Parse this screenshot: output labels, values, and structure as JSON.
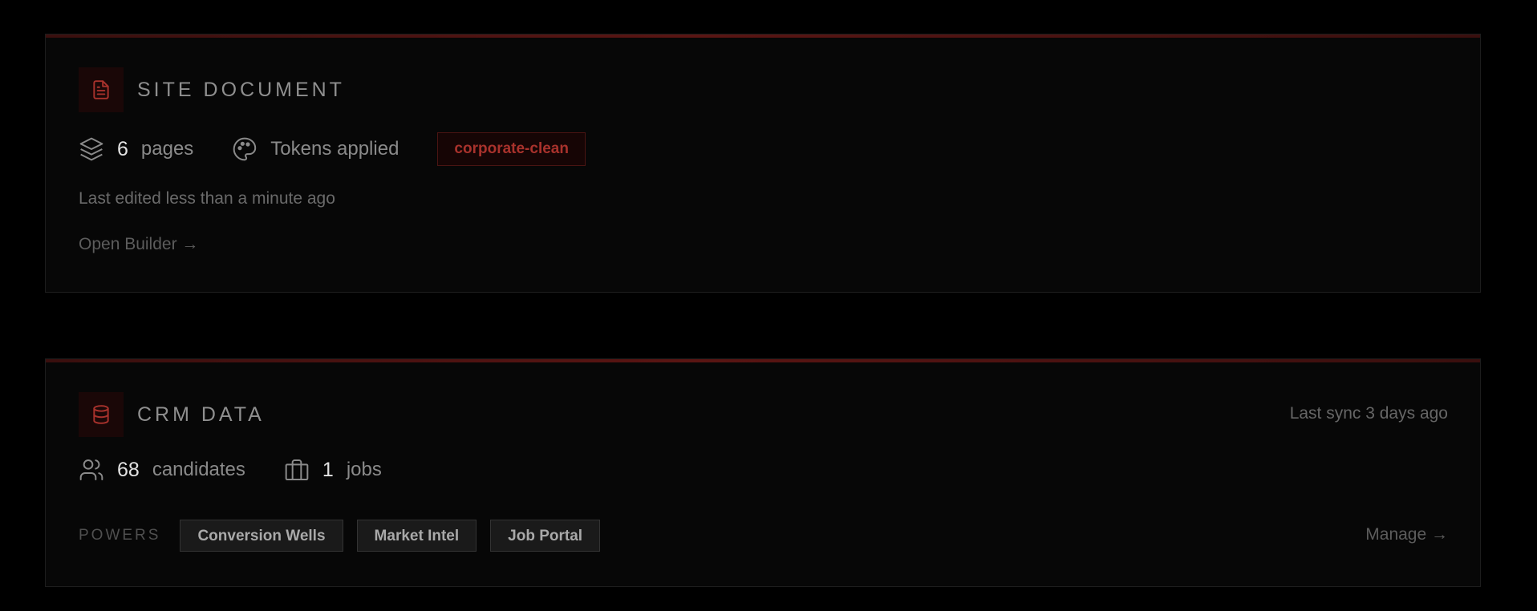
{
  "site_document": {
    "title": "SITE DOCUMENT",
    "icon": "document-icon",
    "pages_count": "6",
    "pages_unit": "pages",
    "tokens_text": "Tokens applied",
    "token_name": "corporate-clean",
    "last_edited": "Last edited less than a minute ago",
    "open_link": "Open Builder →"
  },
  "crm_data": {
    "title": "CRM DATA",
    "icon": "database-icon",
    "last_sync": "Last sync 3 days ago",
    "candidates_count": "68",
    "candidates_unit": "candidates",
    "jobs_count": "1",
    "jobs_unit": "jobs",
    "powers_label": "POWERS",
    "powers": [
      "Conversion Wells",
      "Market Intel",
      "Job Portal"
    ],
    "manage_link": "Manage →"
  },
  "colors": {
    "accent": "#a8322c",
    "background": "#000000",
    "card": "#070707"
  }
}
